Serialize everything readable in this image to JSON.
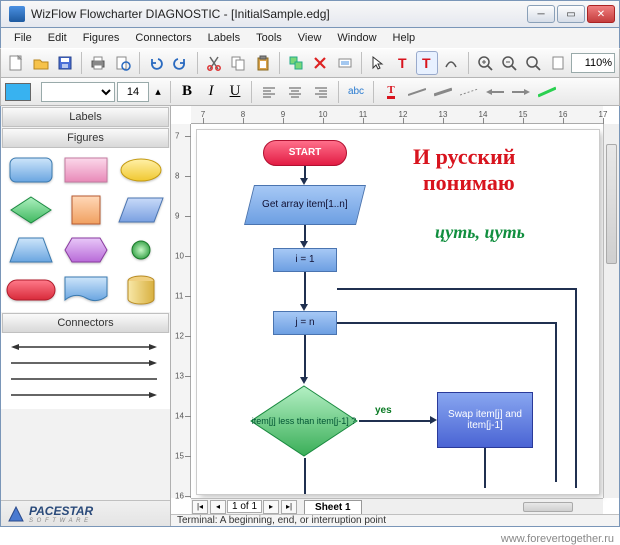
{
  "window": {
    "title": "WizFlow Flowcharter DIAGNOSTIC - [InitialSample.edg]"
  },
  "menu": [
    "File",
    "Edit",
    "Figures",
    "Connectors",
    "Labels",
    "Tools",
    "View",
    "Window",
    "Help"
  ],
  "toolbar": {
    "zoom": "110%"
  },
  "format": {
    "fontsize": "14",
    "bold": "B",
    "italic": "I",
    "under": "U",
    "abc": "abc",
    "tcolor": "T"
  },
  "panels": {
    "labels": "Labels",
    "figures": "Figures",
    "connectors": "Connectors"
  },
  "brand": {
    "name": "PACESTAR",
    "sub": "S O F T W A R E"
  },
  "ruler_h": [
    "7",
    "8",
    "9",
    "10",
    "11",
    "12",
    "13",
    "14",
    "15",
    "16",
    "17"
  ],
  "ruler_v": [
    "7",
    "8",
    "9",
    "10",
    "11",
    "12",
    "13",
    "14",
    "15",
    "16"
  ],
  "flow": {
    "start": "START",
    "getarray": "Get array item[1..n]",
    "i1": "i = 1",
    "jn": "j = n",
    "decision": "item[j] less than item[j-1] ?",
    "swap": "Swap item[j] and item[j-1]",
    "yes": "yes",
    "text_ru1": "И русский",
    "text_ru2": "понимаю",
    "text_ru3": "цуть, цуть"
  },
  "sheet": {
    "page": "1 of 1",
    "tab": "Sheet 1"
  },
  "status": "Terminal: A beginning, end, or interruption point",
  "watermark": "www.forevertogether.ru"
}
